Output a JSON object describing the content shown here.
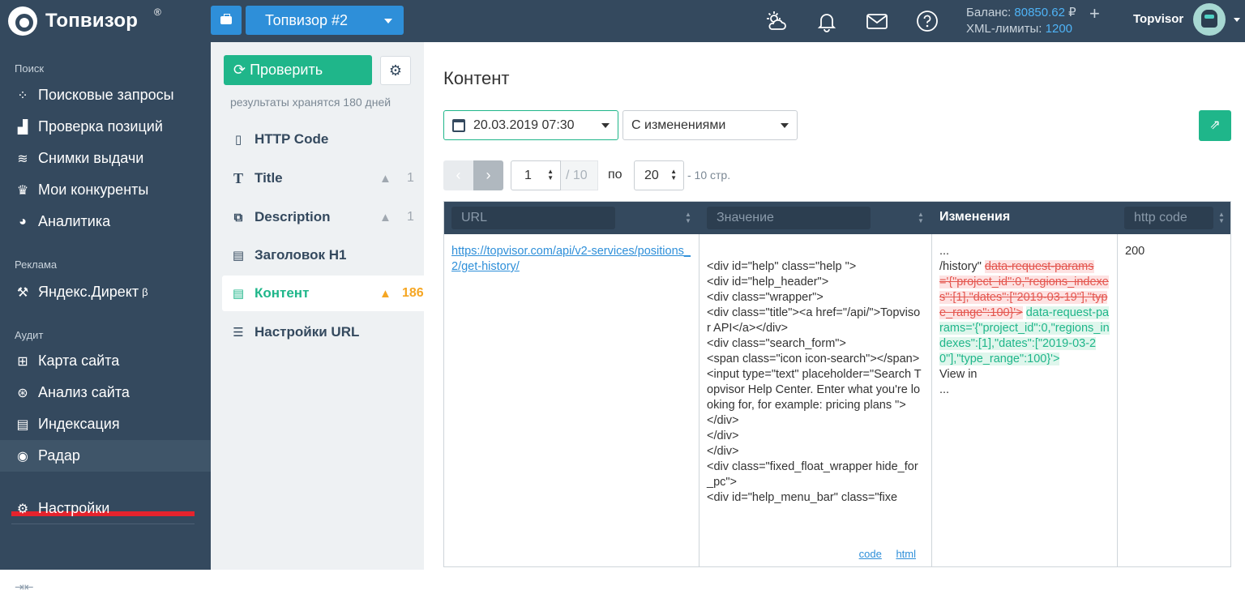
{
  "app": {
    "name": "Топвизор",
    "reg": "®"
  },
  "header": {
    "project": "Топвизор #2",
    "balance_label": "Баланс:",
    "balance_value": "80850.62",
    "currency": "₽",
    "xml_label": "XML-лимиты:",
    "xml_value": "1200",
    "plus": "+",
    "user": "Topvisor"
  },
  "sidebar": {
    "sections": {
      "search": "Поиск",
      "ads": "Реклама",
      "audit": "Аудит"
    },
    "items": [
      {
        "label": "Поисковые запросы",
        "icon": "scatter-icon"
      },
      {
        "label": "Проверка позиций",
        "icon": "bar-chart-icon"
      },
      {
        "label": "Снимки выдачи",
        "icon": "layers-icon"
      },
      {
        "label": "Мои конкуренты",
        "icon": "trophy-icon"
      },
      {
        "label": "Аналитика",
        "icon": "pie-icon"
      },
      {
        "label": "Яндекс.Директ",
        "icon": "hammer-icon",
        "sup": "β"
      },
      {
        "label": "Карта сайта",
        "icon": "sitemap-icon"
      },
      {
        "label": "Анализ сайта",
        "icon": "lifebuoy-icon"
      },
      {
        "label": "Индексация",
        "icon": "newspaper-icon"
      },
      {
        "label": "Радар",
        "icon": "eye-icon"
      },
      {
        "label": "Настройки",
        "icon": "gear-icon"
      }
    ],
    "collapse": "⇥⇤"
  },
  "panel": {
    "check_button": "Проверить",
    "keep_note": "результаты хранятся 180 дней",
    "items": [
      {
        "label": "HTTP Code",
        "icon": "file-icon",
        "count": ""
      },
      {
        "label": "Title",
        "icon": "text-t-icon",
        "count": "1"
      },
      {
        "label": "Description",
        "icon": "code-file-icon",
        "count": "1"
      },
      {
        "label": "Заголовок H1",
        "icon": "newspaper-icon",
        "count": ""
      },
      {
        "label": "Контент",
        "icon": "document-icon",
        "count": "186"
      },
      {
        "label": "Настройки URL",
        "icon": "list-icon",
        "count": ""
      }
    ]
  },
  "main": {
    "title": "Контент",
    "date": "20.03.2019 07:30",
    "mode": "С изменениями",
    "page": "1",
    "total_pages": "/ 10",
    "per_label": "по",
    "per_page": "20",
    "pages_note": "- 10 стр."
  },
  "table": {
    "headers": {
      "url": "URL",
      "value": "Значение",
      "changes": "Изменения",
      "http": "http code"
    },
    "row": {
      "url": "https://topvisor.com/api/v2-services/positions_2/get-history/",
      "value": "\n<div id=\"help\" class=\"help \">\n<div id=\"help_header\">\n<div class=\"wrapper\">\n<div class=\"title\"><a href=\"/api/\">Topvisor API</a></div>\n<div class=\"search_form\">\n<span class=\"icon icon-search\"></span>\n<input type=\"text\" placeholder=\"Search Topvisor Help Center. Enter what you're looking for, for example: pricing plans \">\n</div>\n</div>\n</div>\n<div class=\"fixed_float_wrapper hide_for_pc\">\n<div id=\"help_menu_bar\" class=\"fixe",
      "changes_pre": "...\n/history\" ",
      "changes_del": "data-request-params='{\"project_id\":0,\"regions_indexes\":[1],\"dates\":[\"2019-03-19\"],\"type_range\":100}'>",
      "changes_ins": "data-request-params='{\"project_id\":0,\"regions_indexes\":[1],\"dates\":[\"2019-03-20\"],\"type_range\":100}'>",
      "changes_post": "\nView in\n...",
      "http_code": "200",
      "link_code": "code",
      "link_html": "html"
    }
  }
}
